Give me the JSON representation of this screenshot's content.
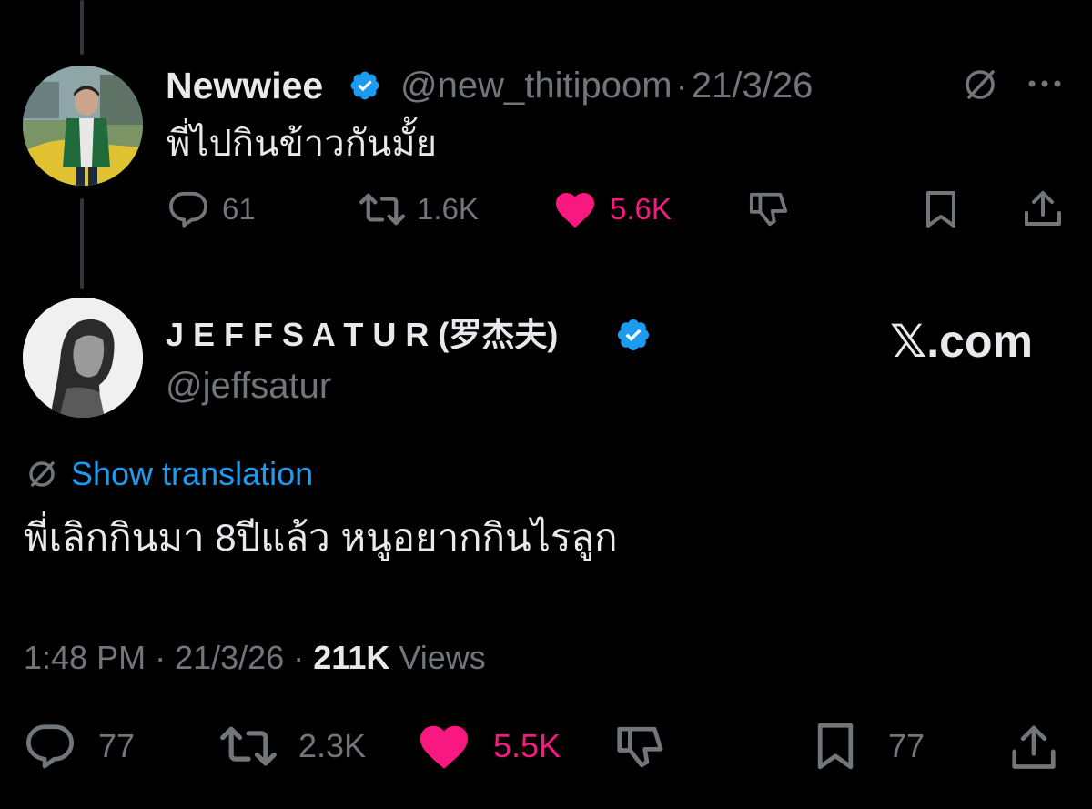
{
  "parent_tweet": {
    "display_name": "Newwiee",
    "handle": "@new_thitipoom",
    "separator": "·",
    "date": "21/3/26",
    "text": "พี่ไปกินข้าวกันมั้ย",
    "replies": "61",
    "reposts": "1.6K",
    "likes": "5.6K",
    "icons": [
      "verified-badge-icon",
      "translate-icon",
      "more-icon",
      "reply-icon",
      "repost-icon",
      "like-icon",
      "dislike-icon",
      "bookmark-icon",
      "share-icon"
    ]
  },
  "main_tweet": {
    "display_name": "J E F F S A T U R (罗杰夫)",
    "handle": "@jeffsatur",
    "brand": "𝕏.com",
    "show_translation": "Show translation",
    "text": "พี่เลิกกินมา 8ปีแล้ว หนูอยากกินไรลูก",
    "time": "1:48 PM",
    "separator": "·",
    "date": "21/3/26",
    "separator2": "·",
    "views_count": "211K",
    "views_label": "Views",
    "replies": "77",
    "reposts": "2.3K",
    "likes": "5.5K",
    "bookmarks": "77"
  },
  "colors": {
    "background": "#000000",
    "text": "#e7e9ea",
    "muted": "#71767b",
    "like": "#f91880",
    "link": "#1d9bf0",
    "verified": "#1d9bf0"
  }
}
